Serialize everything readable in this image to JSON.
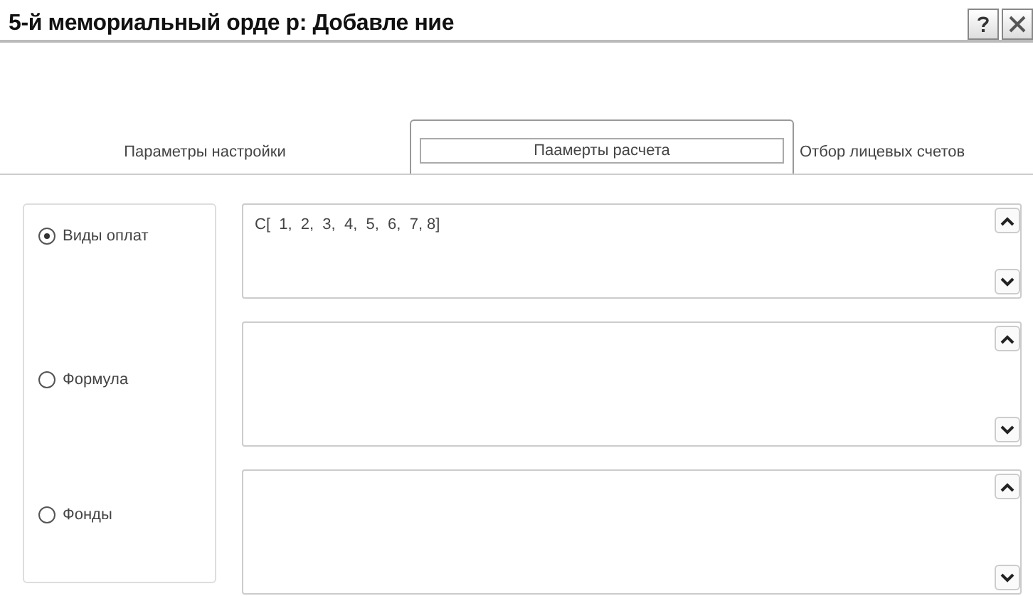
{
  "window": {
    "title": "5-й мемориальный орде р: Добавле ние"
  },
  "tabs": [
    {
      "label": "Параметры настройки",
      "selected": false
    },
    {
      "label": "Паамерты расчета",
      "selected": true
    },
    {
      "label": "Отбор лицевых счетов",
      "selected": false
    }
  ],
  "options": [
    {
      "label": "Виды оплат",
      "selected": true,
      "value": "C[  1,  2,  3,  4,  5,  6,  7, 8]"
    },
    {
      "label": "Формула",
      "selected": false
    },
    {
      "label": "Фонды",
      "selected": false
    }
  ]
}
